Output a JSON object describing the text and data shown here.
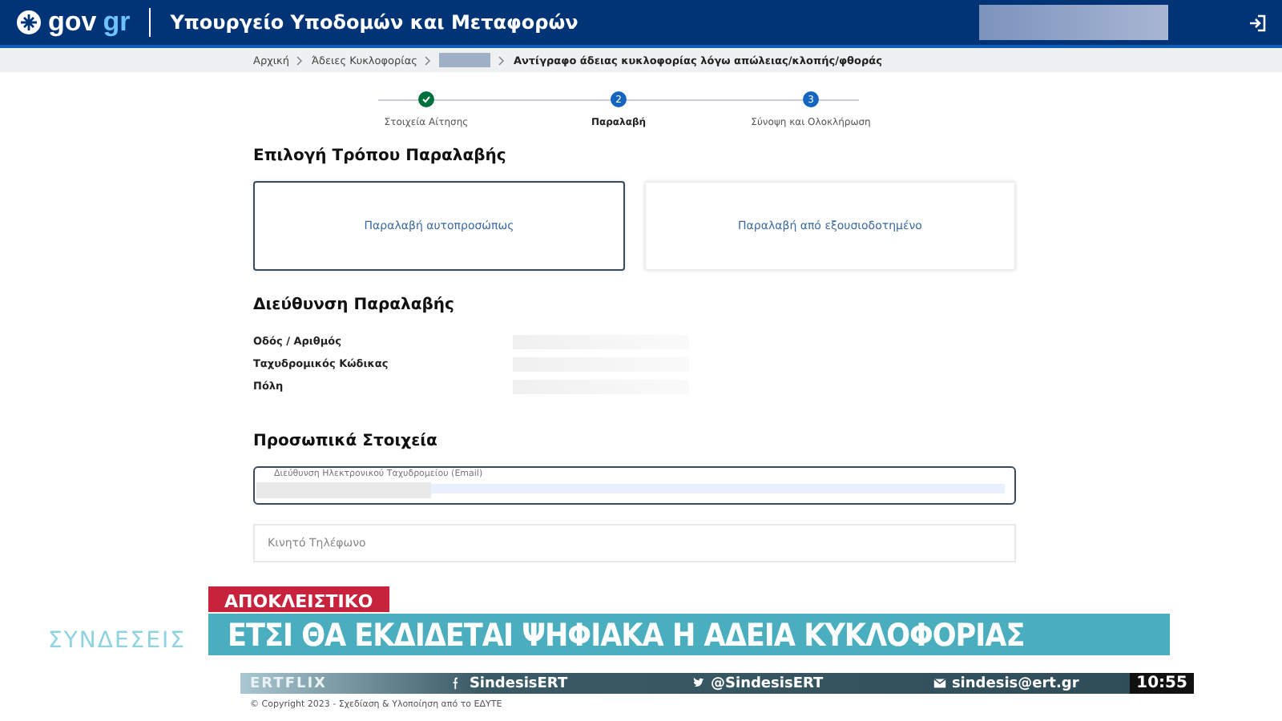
{
  "header": {
    "logo_main": "gov",
    "logo_accent": "gr",
    "title": "Υπουργείο Υποδομών και Μεταφορών"
  },
  "breadcrumb": [
    {
      "kind": "link",
      "text": "Αρχική"
    },
    {
      "kind": "link",
      "text": "Άδειες Κυκλοφορίας"
    },
    {
      "kind": "hidden"
    },
    {
      "kind": "current",
      "text": "Αντίγραφο άδειας κυκλοφορίας λόγω απώλειας/κλοπής/φθοράς"
    }
  ],
  "steps": [
    {
      "label": "Στοιχεία Αίτησης",
      "completed": true,
      "selected": false
    },
    {
      "number": "2",
      "label": "Παραλαβή",
      "completed": false,
      "selected": true
    },
    {
      "number": "3",
      "label": "Σύνοψη και Ολοκλήρωση",
      "completed": false,
      "selected": false
    }
  ],
  "delivery": {
    "title": "Επιλογή Τρόπου Παραλαβής",
    "options": [
      {
        "label": "Παραλαβή αυτοπροσώπως",
        "selected": true
      },
      {
        "label": "Παραλαβή από εξουσιοδοτημένο",
        "selected": false
      }
    ]
  },
  "address": {
    "title": "Διεύθυνση Παραλαβής",
    "fields": [
      "Οδός / Αριθμός",
      "Ταχυδρομικός Κώδικας",
      "Πόλη"
    ]
  },
  "personal": {
    "title": "Προσωπικά Στοιχεία",
    "email_label": "Διεύθυνση Ηλεκτρονικού Ταχυδρομείου (Email)",
    "email_focused": true,
    "phone_placeholder": "Κινητό Τηλέφωνο"
  },
  "footer": {
    "copyright": "© Copyright 2023 - Σχεδίαση & Υλοποίηση από το ΕΔΥΤΕ"
  },
  "broadcast": {
    "show": "ΣΥΝΔΕΣΕΙΣ",
    "tag": "ΑΠΟΚΛΕΙΣΤΙΚΟ",
    "headline": "ΕΤΣΙ ΘΑ ΕΚΔΙΔΕΤΑΙ ΨΗΦΙΑΚΑ Η ΑΔΕΙΑ ΚΥΚΛΟΦΟΡΙΑΣ",
    "brand": "ERTFLIX",
    "contacts": [
      {
        "kind": "facebook",
        "text": "SindesisERT"
      },
      {
        "kind": "twitter",
        "text": "@SindesisERT"
      },
      {
        "kind": "mail",
        "text": "sindesis@ert.gr"
      }
    ],
    "clock": "10:55"
  }
}
